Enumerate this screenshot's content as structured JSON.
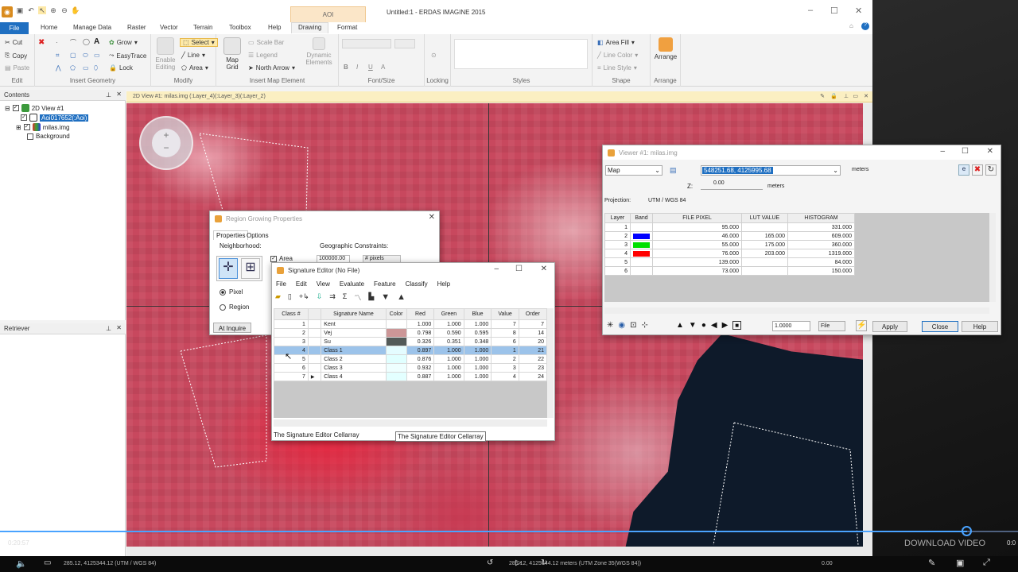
{
  "app": {
    "title": "Untitled:1 - ERDAS IMAGINE 2015",
    "context_tab": "AOI"
  },
  "tabs": [
    "File",
    "Home",
    "Manage Data",
    "Raster",
    "Vector",
    "Terrain",
    "Toolbox",
    "Help",
    "Drawing",
    "Format"
  ],
  "ribbon": {
    "edit": {
      "label": "Edit",
      "cut": "Cut",
      "copy": "Copy",
      "paste": "Paste"
    },
    "insert_geometry": {
      "label": "Insert Geometry",
      "grow": "Grow",
      "easytrace": "EasyTrace",
      "lock": "Lock"
    },
    "modify": {
      "label": "Modify",
      "enable_editing": "Enable Editing",
      "select": "Select",
      "line": "Line",
      "area": "Area"
    },
    "insert_map": {
      "label": "Insert Map Element",
      "map_grid": "Map Grid",
      "scale_bar": "Scale Bar",
      "legend": "Legend",
      "north_arrow": "North Arrow",
      "dynamic": "Dynamic Elements"
    },
    "font_size": {
      "label": "Font/Size"
    },
    "locking": {
      "label": "Locking"
    },
    "styles": {
      "label": "Styles"
    },
    "shape": {
      "label": "Shape",
      "area_fill": "Area Fill",
      "line_color": "Line Color",
      "line_style": "Line Style"
    },
    "arrange": {
      "label": "Arrange",
      "arrange": "Arrange"
    }
  },
  "contents": {
    "title": "Contents",
    "view": "2D View #1",
    "aoi": "Aoi017652(:Aoi)",
    "img": "milas.img",
    "bg": "Background"
  },
  "retriever": {
    "title": "Retriever"
  },
  "view_header": "2D View #1: milas.img (:Layer_4)(:Layer_3)(:Layer_2)",
  "region": {
    "title": "Region Growing Properties",
    "tab_props": "Properties",
    "tab_options": "Options",
    "neighborhood": "Neighborhood:",
    "geo": "Geographic Constraints:",
    "area": "Area",
    "area_val": "100000.00",
    "units": "# pixels",
    "pixel": "Pixel",
    "region": "Region",
    "inquire": "At Inquire"
  },
  "sig": {
    "title": "Signature Editor (No File)",
    "menu": [
      "File",
      "Edit",
      "View",
      "Evaluate",
      "Feature",
      "Classify",
      "Help"
    ],
    "headers": [
      "Class #",
      "",
      "Signature Name",
      "Color",
      "Red",
      "Green",
      "Blue",
      "Value",
      "Order"
    ],
    "rows": [
      {
        "n": "1",
        "name": "Kent",
        "color": "#ffffff",
        "red": "1.000",
        "green": "1.000",
        "blue": "1.000",
        "value": "7",
        "order": "7"
      },
      {
        "n": "2",
        "name": "Vej",
        "color": "#cc9697",
        "red": "0.798",
        "green": "0.590",
        "blue": "0.595",
        "value": "8",
        "order": "14"
      },
      {
        "n": "3",
        "name": "Su",
        "color": "#535a58",
        "red": "0.326",
        "green": "0.351",
        "blue": "0.348",
        "value": "6",
        "order": "20"
      },
      {
        "n": "4",
        "name": "Class 1",
        "color": "#e4fcff",
        "red": "0.897",
        "green": "1.000",
        "blue": "1.000",
        "value": "1",
        "order": "21",
        "selected": true
      },
      {
        "n": "5",
        "name": "Class 2",
        "color": "#e0ffff",
        "red": "0.876",
        "green": "1.000",
        "blue": "1.000",
        "value": "2",
        "order": "22"
      },
      {
        "n": "6",
        "name": "Class 3",
        "color": "#eeffff",
        "red": "0.932",
        "green": "1.000",
        "blue": "1.000",
        "value": "3",
        "order": "23"
      },
      {
        "n": "7",
        "name": "Class 4",
        "color": "#e3ffff",
        "red": "0.887",
        "green": "1.000",
        "blue": "1.000",
        "value": "4",
        "order": "24",
        "current": true
      }
    ],
    "status": "The Signature Editor Cellarray",
    "tooltip": "The Signature Editor Cellarray"
  },
  "inq": {
    "title": "Viewer #1:  milas.img",
    "type": "Map",
    "coords": "548251.68, 4125995.68",
    "units": "meters",
    "z_label": "Z:",
    "z_val": "0.00",
    "z_units": "meters",
    "proj_label": "Projection:",
    "proj": "UTM / WGS 84",
    "headers": [
      "Layer",
      "Band",
      "FILE PIXEL",
      "LUT VALUE",
      "HISTOGRAM"
    ],
    "rows": [
      {
        "layer": "1",
        "band": "",
        "pixel": "95.000",
        "lut": "",
        "hist": "331.000"
      },
      {
        "layer": "2",
        "band": "#0000ff",
        "pixel": "46.000",
        "lut": "165.000",
        "hist": "609.000"
      },
      {
        "layer": "3",
        "band": "#00e000",
        "pixel": "55.000",
        "lut": "175.000",
        "hist": "360.000"
      },
      {
        "layer": "4",
        "band": "#ff0000",
        "pixel": "76.000",
        "lut": "203.000",
        "hist": "1319.000"
      },
      {
        "layer": "5",
        "band": "",
        "pixel": "139.000",
        "lut": "",
        "hist": "84.000"
      },
      {
        "layer": "6",
        "band": "",
        "pixel": "73.000",
        "lut": "",
        "hist": "150.000"
      }
    ],
    "scale": "1.0000",
    "file": "File",
    "apply": "Apply",
    "close": "Close",
    "help": "Help"
  },
  "player": {
    "time": "0:20:57",
    "download": "DOWNLOAD VIDEO",
    "end_time": "0:0",
    "progress": 0.95
  },
  "statusbar": {
    "left": "285.12, 4125344.12  (UTM / WGS 84)",
    "center": "285.12, 4125344.12 meters (UTM Zone 35(WGS 84))",
    "right": "0.00"
  }
}
